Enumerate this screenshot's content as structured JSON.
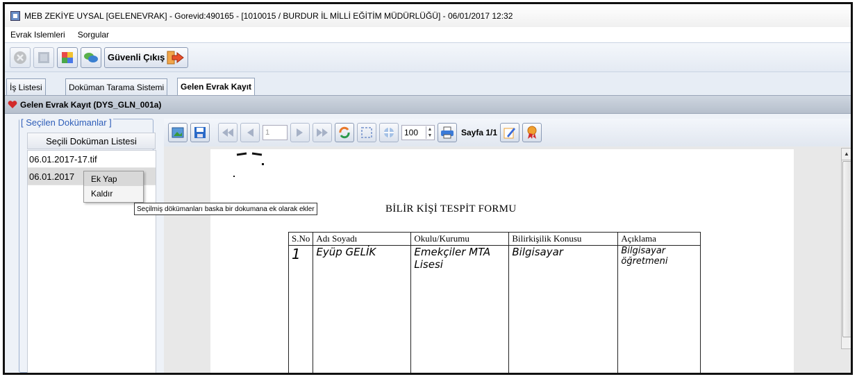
{
  "window": {
    "title": "MEB  ZEKİYE UYSAL  [GELENEVRAK] - Gorevid:490165 - [1010015 / BURDUR İL MİLLİ EĞİTİM MÜDÜRLÜĞÜ] - 06/01/2017 12:32"
  },
  "menu": {
    "items": [
      {
        "label": "Evrak Islemleri"
      },
      {
        "label": "Sorgular"
      }
    ]
  },
  "toolbar": {
    "guvenli_cikis": "Güvenli Çıkış"
  },
  "tabs": [
    {
      "label": "İş Listesi",
      "active": false
    },
    {
      "label": "Doküman Tarama Sistemi",
      "active": false
    },
    {
      "label": "Gelen Evrak Kayıt",
      "active": true
    }
  ],
  "panel": {
    "title": "Gelen Evrak Kayıt (DYS_GLN_001a)"
  },
  "left": {
    "group_title": "[ Seçilen Dokümanlar ]",
    "list_header": "Seçili Doküman Listesi",
    "items": [
      {
        "label": "06.01.2017-17.tif"
      },
      {
        "label": "06.01.2017"
      }
    ]
  },
  "context_menu": {
    "items": [
      {
        "label": "Ek Yap"
      },
      {
        "label": "Kaldır"
      }
    ]
  },
  "tooltip": {
    "text": "Seçilmiş dökümanları baska bir dokumana ek olarak ekler"
  },
  "viewer": {
    "page_number": "1",
    "zoom": "100",
    "page_label": "Sayfa 1/1"
  },
  "document": {
    "title": "BİLİR KİŞİ TESPİT FORMU",
    "columns": [
      "S.No",
      "Adı Soyadı",
      "Okulu/Kurumu",
      "Bilirkişilik Konusu",
      "Açıklama"
    ],
    "row": [
      "1",
      "Eyüp GELİK",
      "Emekçiler MTA Lisesi",
      "Bilgisayar",
      "Bilgisayar öğretmeni"
    ]
  },
  "colors": {
    "accent_blue": "#2f5eb8",
    "exit_arrow": "#e8502a"
  }
}
